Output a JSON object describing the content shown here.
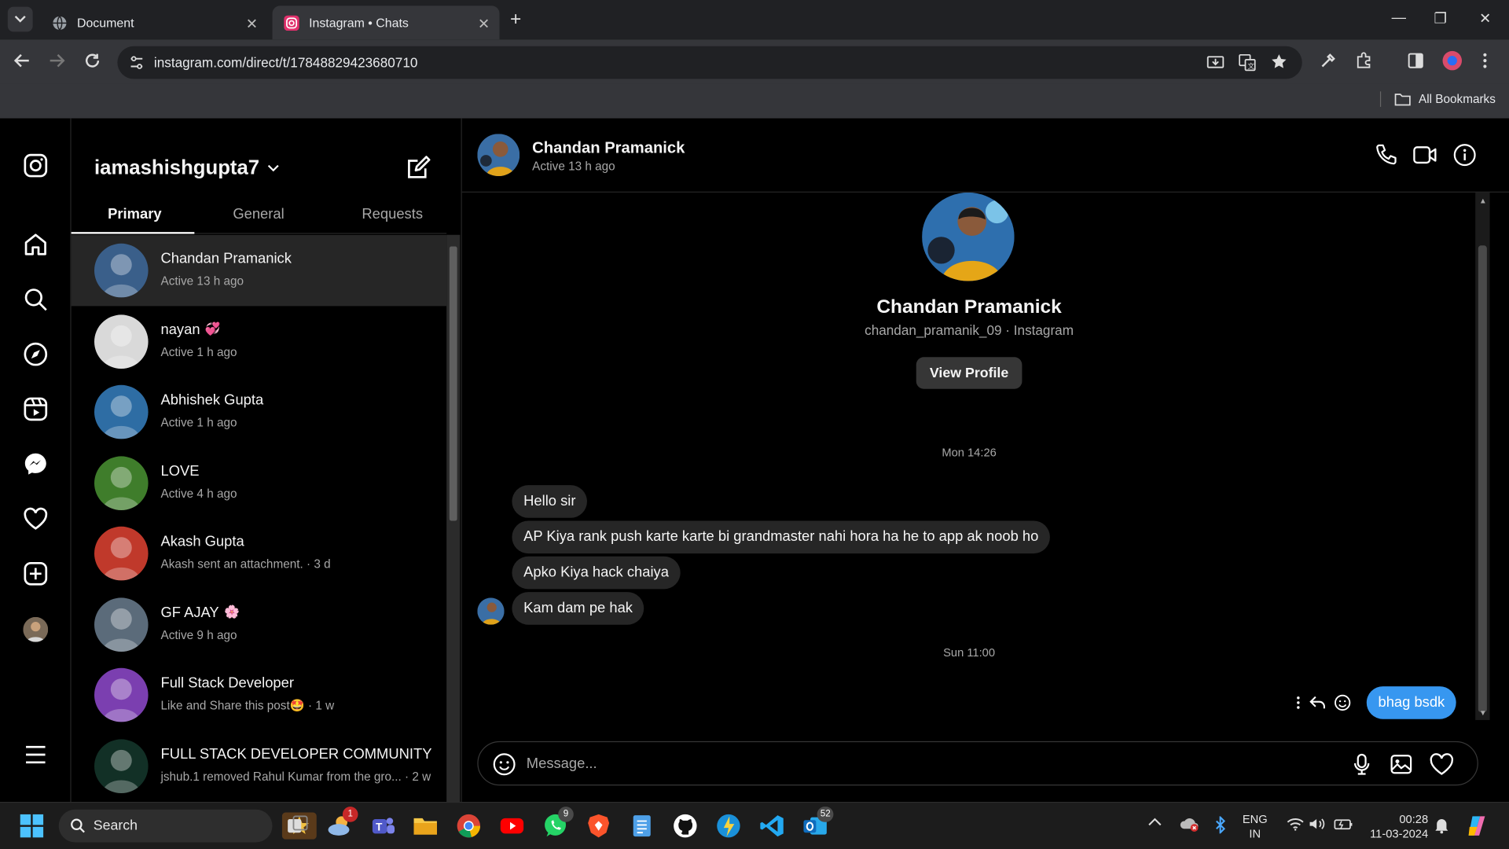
{
  "browser": {
    "tabs": [
      {
        "title": "Document"
      },
      {
        "title": "Instagram • Chats"
      }
    ],
    "url": "instagram.com/direct/t/17848829423680710",
    "bookmarks_label": "All Bookmarks"
  },
  "inbox": {
    "username": "iamashishgupta7",
    "tabs": [
      {
        "label": "Primary"
      },
      {
        "label": "General"
      },
      {
        "label": "Requests"
      }
    ],
    "conversations": [
      {
        "name": "Chandan Pramanick",
        "sub": "Active 13 h ago",
        "emoji": "",
        "color": "#3a5f8a"
      },
      {
        "name": "nayan",
        "sub": "Active 1 h ago",
        "emoji": "💞",
        "color": "#d9d9d9"
      },
      {
        "name": "Abhishek Gupta",
        "sub": "Active 1 h ago",
        "emoji": "",
        "color": "#2e6da4"
      },
      {
        "name": "LOVE",
        "sub": "Active 4 h ago",
        "emoji": "",
        "color": "#3f7d2b"
      },
      {
        "name": "Akash Gupta",
        "sub": "Akash sent an attachment. · 3 d",
        "emoji": "",
        "color": "#c0392b"
      },
      {
        "name": "GF AJAY",
        "sub": "Active 9 h ago",
        "emoji": "🌸",
        "color": "#5b6b7a"
      },
      {
        "name": "Full Stack Developer",
        "sub": "Like and Share this post🤩 · 1 w",
        "emoji": "",
        "color": "#7b3fb0"
      },
      {
        "name": "FULL STACK DEVELOPER COMMUNITY",
        "sub": "jshub.1 removed Rahul Kumar from the gro... · 2 w",
        "emoji": "",
        "color": "#123026"
      }
    ]
  },
  "chat": {
    "contact_name": "Chandan Pramanick",
    "status": "Active 13 h ago",
    "handle": "chandan_pramanik_09 · Instagram",
    "view_profile": "View Profile",
    "day1": "Mon 14:26",
    "messages": [
      {
        "text": "Hello sir"
      },
      {
        "text": "AP Kiya rank push karte karte  bi grandmaster nahi hora ha he to app ak noob ho"
      },
      {
        "text": "Apko Kiya hack chaiya"
      },
      {
        "text": "Kam dam pe hak"
      }
    ],
    "day2": "Sun 11:00",
    "outgoing": "bhag bsdk",
    "composer_placeholder": "Message..."
  },
  "taskbar": {
    "search_label": "Search",
    "badges": {
      "weather": "1",
      "whatsapp": "9",
      "outlook": "52"
    },
    "lang_top": "ENG",
    "lang_bottom": "IN",
    "time": "00:28",
    "date": "11-03-2024"
  },
  "colors": {
    "accent": "#3797f0",
    "bubble": "#262626",
    "bg": "#000000"
  }
}
